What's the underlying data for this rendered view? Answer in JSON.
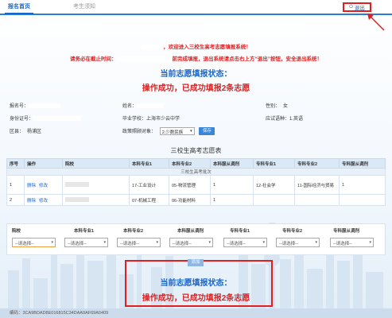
{
  "nav": {
    "tab_home": "报名首页",
    "tab_exam": "考生须知",
    "logout_label": "退出"
  },
  "welcome": {
    "line1_suffix": "，欢迎进入三校生高考志愿填报系统！",
    "deadline_prefix": "请务必在截止时间：",
    "deadline_suffix": "前完成填报，退出系统请点击右上方“退出”按钮，安全退出系统！",
    "status_heading": "当前志愿填报状态：",
    "status_text": "操作成功，已成功填报2条志愿"
  },
  "info": {
    "reg_no_label": "报名号：",
    "name_label": "姓名：",
    "gender_label": "性别：",
    "gender_value": "女",
    "id_label": "身份证号：",
    "school_label": "毕业学校：",
    "school_value": "上海市少云中学",
    "lang_label": "应试语种：",
    "lang_value": "1.英语",
    "district_label": "区县：",
    "district_value": "杨浦区",
    "policy_label": "政策照顾对象：",
    "policy_value": "2.少数民族",
    "save_label": "保存"
  },
  "table": {
    "title": "三校生高考志愿表",
    "headers": [
      "序号",
      "操作",
      "院校",
      "本科专业1",
      "本科专业2",
      "本科服从调剂",
      "专科专业1",
      "专科专业2",
      "专科服从调剂"
    ],
    "batch_label": "三校生高考批次",
    "delete_label": "删除",
    "edit_label": "修改",
    "rows": [
      {
        "idx": "1",
        "major1": "17-工业设计",
        "major2": "05-物流管理",
        "obey": "1",
        "jmajor1": "12-社会学",
        "jmajor2": "11-国际经济与贸易",
        "jobey": "1"
      },
      {
        "idx": "2",
        "major1": "07-机械工程",
        "major2": "06-功能材料",
        "obey": "1",
        "jmajor1": "",
        "jmajor2": "",
        "jobey": ""
      }
    ]
  },
  "addform": {
    "headers": [
      "院校",
      "本科专业1",
      "本科专业2",
      "本科服从调剂",
      "专科专业1",
      "专科专业2",
      "专科服从调剂"
    ],
    "placeholder": "--请选择--",
    "add_label": "添加"
  },
  "bottom": {
    "status_heading": "当前志愿填报状态：",
    "status_text": "操作成功，已成功填报2条志愿"
  },
  "footer": {
    "code_label": "编码：",
    "code_value": "3CA9BDAD8E016815C34DAA9AF69A0409"
  },
  "colors": {
    "accent": "#1a66c9",
    "alert": "#e02020",
    "header_bg": "#dbe8f6"
  }
}
